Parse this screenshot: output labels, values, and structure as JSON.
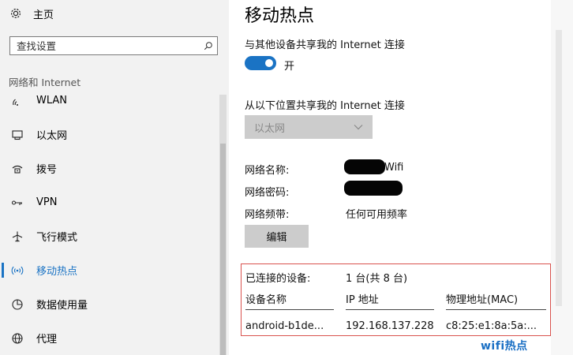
{
  "sidebar": {
    "home_label": "主页",
    "search_placeholder": "查找设置",
    "section_label": "网络和 Internet",
    "items": [
      {
        "label": "WLAN",
        "icon": "wifi-icon"
      },
      {
        "label": "以太网",
        "icon": "ethernet-icon"
      },
      {
        "label": "拨号",
        "icon": "dialup-icon"
      },
      {
        "label": "VPN",
        "icon": "vpn-icon"
      },
      {
        "label": "飞行模式",
        "icon": "airplane-icon"
      },
      {
        "label": "移动热点",
        "icon": "hotspot-icon",
        "active": true
      },
      {
        "label": "数据使用量",
        "icon": "data-usage-icon"
      },
      {
        "label": "代理",
        "icon": "globe-icon"
      }
    ]
  },
  "main": {
    "title": "移动热点",
    "share_label": "与其他设备共享我的 Internet 连接",
    "toggle_state": "开",
    "share_from_label": "从以下位置共享我的 Internet 连接",
    "share_from_value": "以太网",
    "network_name_label": "网络名称:",
    "network_name_suffix": "Wifi",
    "network_password_label": "网络密码:",
    "network_band_label": "网络频带:",
    "network_band_value": "任何可用频率",
    "edit_button": "编辑",
    "connected_label": "已连接的设备:",
    "connected_value": "1 台(共 8 台)",
    "columns": [
      "设备名称",
      "IP 地址",
      "物理地址(MAC)"
    ],
    "devices": [
      {
        "name": "android-b1de...",
        "ip": "192.168.137.228",
        "mac": "c8:25:e1:8a:5a:..."
      }
    ]
  },
  "watermark": "wifi热点",
  "colors": {
    "accent": "#1a73c4",
    "highlight_border": "#d9534f",
    "sidebar_bg": "#f2f2f2"
  }
}
